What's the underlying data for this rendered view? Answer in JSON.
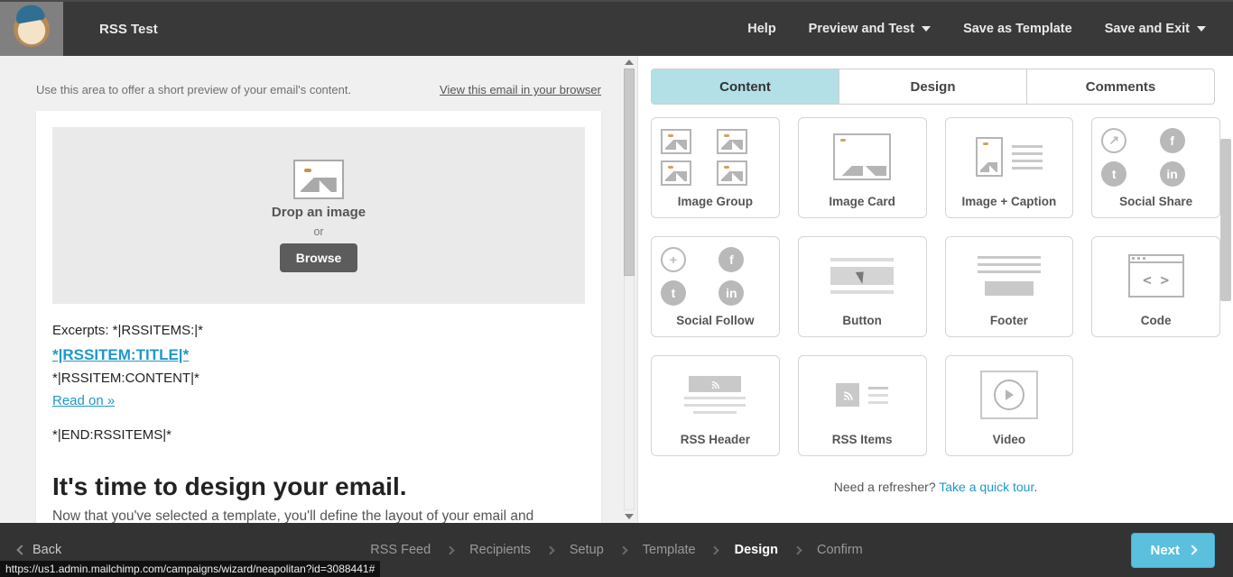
{
  "topbar": {
    "app_title": "RSS Test",
    "actions": [
      "Help",
      "Preview and Test",
      "Save as Template",
      "Save and Exit"
    ]
  },
  "canvas": {
    "preview_placeholder": "Use this area to offer a short preview of your email's content.",
    "view_in_browser": "View this email in your browser",
    "drop_label": "Drop an image",
    "or_label": "or",
    "browse_label": "Browse",
    "rss": {
      "excerpts_prefix": "Excerpts: *|RSSITEMS:|*",
      "title_tag": "*|RSSITEM:TITLE|*",
      "content_tag": "*|RSSITEM:CONTENT|*",
      "read_on": "Read on »",
      "end_tag": "*|END:RSSITEMS|*"
    },
    "heading": "It's time to design your email.",
    "body": "Now that you've selected a template, you'll define the layout of your email and"
  },
  "right": {
    "tabs": [
      "Content",
      "Design",
      "Comments"
    ],
    "active_tab": 0,
    "blocks_row1": [
      "Image Group",
      "Image Card",
      "Image + Caption",
      "Social Share"
    ],
    "blocks_row2": [
      "Social Follow",
      "Button",
      "Footer",
      "Code"
    ],
    "blocks_row3": [
      "RSS Header",
      "RSS Items",
      "Video"
    ],
    "refresher_prefix": "Need a refresher? ",
    "refresher_link": "Take a quick tour",
    "refresher_suffix": "."
  },
  "bottom": {
    "back": "Back",
    "steps": [
      "RSS Feed",
      "Recipients",
      "Setup",
      "Template",
      "Design",
      "Confirm"
    ],
    "active_step": 4,
    "next": "Next"
  },
  "status_url": "https://us1.admin.mailchimp.com/campaigns/wizard/neapolitan?id=3088441#"
}
